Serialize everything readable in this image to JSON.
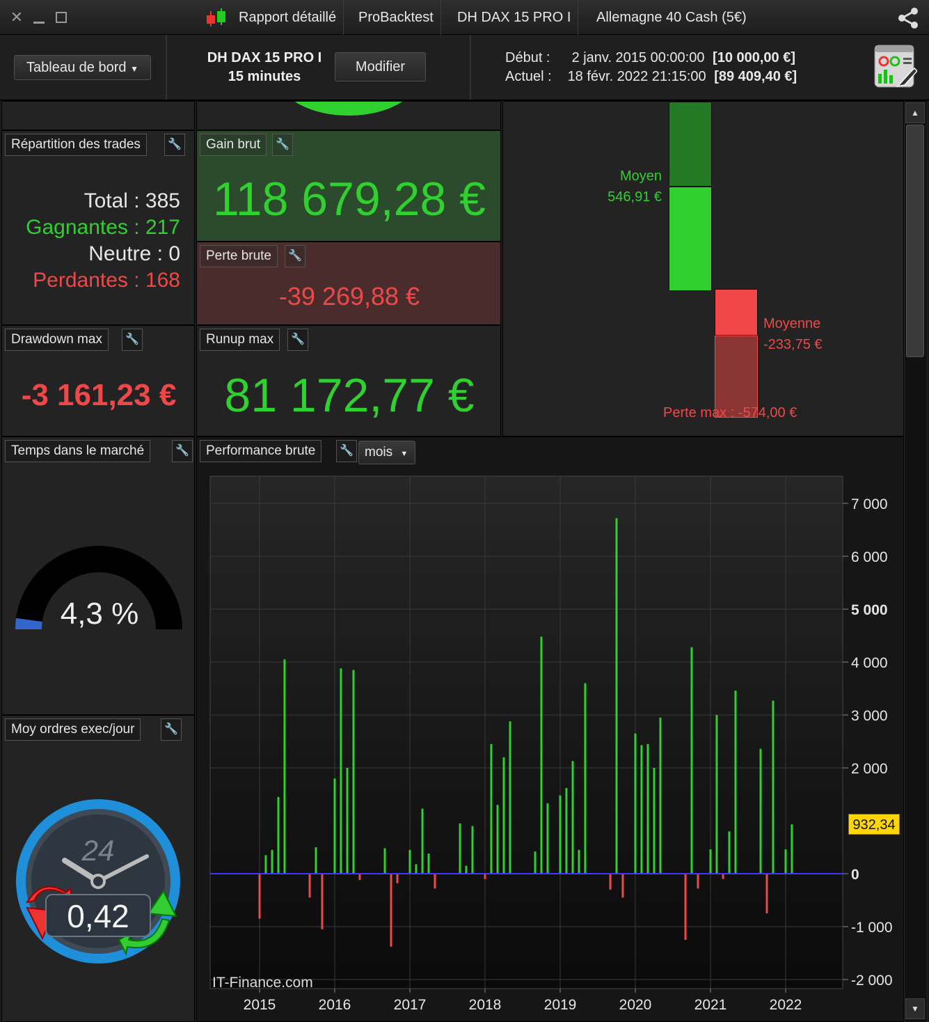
{
  "titlebar": {
    "tabs": [
      "Rapport détaillé",
      "ProBacktest",
      "DH DAX 15 PRO I",
      "Allemagne 40 Cash (5€)"
    ]
  },
  "header": {
    "dropdown_label": "Tableau de bord",
    "strategy_name": "DH DAX 15 PRO I",
    "timeframe": "15 minutes",
    "modify_label": "Modifier",
    "debut_label": "Début :",
    "debut_date": "2 janv. 2015 00:00:00",
    "debut_capital": "[10 000,00 €]",
    "actuel_label": "Actuel :",
    "actuel_date": "18 févr. 2022 21:15:00",
    "actuel_capital": "[89 409,40 €]"
  },
  "trades": {
    "title": "Répartition des trades",
    "total": "Total : 385",
    "gagnantes": "Gagnantes : 217",
    "neutre": "Neutre : 0",
    "perdantes": "Perdantes : 168"
  },
  "gain_brut": {
    "title": "Gain brut",
    "value": "118 679,28 €"
  },
  "perte_brute": {
    "title": "Perte brute",
    "value": "-39 269,88 €"
  },
  "drawdown": {
    "title": "Drawdown max",
    "value": "-3 161,23 €"
  },
  "runup": {
    "title": "Runup max",
    "value": "81 172,77 €"
  },
  "avg_bars": {
    "gain_label": "Moyen",
    "gain_value": "546,91 €",
    "loss_label": "Moyenne",
    "loss_value": "-233,75 €",
    "max_loss": "Perte max : -574,00 €"
  },
  "market_time": {
    "title": "Temps dans le marché",
    "value": "4,3 %",
    "fraction": 0.043
  },
  "orders": {
    "title": "Moy ordres exec/jour",
    "value": "0,42",
    "dial": "24"
  },
  "performance": {
    "title": "Performance brute",
    "period": "mois",
    "watermark": "IT-Finance.com",
    "current_value": "932,34"
  },
  "colors": {
    "positive": "#2fd02f",
    "negative": "#f04848",
    "zero_line": "#3a3aff",
    "highlight": "#ffd700"
  },
  "chart_data": {
    "type": "bar",
    "ylim": [
      -2200,
      7000
    ],
    "yticks": [
      "7 000",
      "6 000",
      "5 000",
      "4 000",
      "3 000",
      "2 000",
      "0",
      "-1 000",
      "-2 000"
    ],
    "ytick_values": [
      7000,
      6000,
      5000,
      4000,
      3000,
      2000,
      0,
      -1000,
      -2000
    ],
    "xticks": [
      "2015",
      "2016",
      "2017",
      "2018",
      "2019",
      "2020",
      "2021",
      "2022"
    ],
    "xtick_values": [
      2015,
      2016,
      2017,
      2018,
      2019,
      2020,
      2021,
      2022
    ],
    "grid": true,
    "x": [
      2015.0,
      2015.083,
      2015.167,
      2015.25,
      2015.333,
      2015.667,
      2015.75,
      2015.833,
      2016.0,
      2016.083,
      2016.167,
      2016.25,
      2016.333,
      2016.667,
      2016.75,
      2016.833,
      2017.0,
      2017.083,
      2017.167,
      2017.25,
      2017.333,
      2017.667,
      2017.75,
      2017.833,
      2018.0,
      2018.083,
      2018.167,
      2018.25,
      2018.333,
      2018.667,
      2018.75,
      2018.833,
      2019.0,
      2019.083,
      2019.167,
      2019.25,
      2019.333,
      2019.667,
      2019.75,
      2019.833,
      2020.0,
      2020.083,
      2020.167,
      2020.25,
      2020.333,
      2020.667,
      2020.75,
      2020.833,
      2021.0,
      2021.083,
      2021.167,
      2021.25,
      2021.333,
      2021.667,
      2021.75,
      2021.833,
      2022.0,
      2022.083
    ],
    "values": [
      -850,
      350,
      450,
      1450,
      4050,
      -450,
      500,
      -1050,
      1800,
      3880,
      2000,
      3850,
      -120,
      480,
      -1380,
      -180,
      450,
      180,
      1230,
      380,
      -280,
      950,
      150,
      900,
      -100,
      2450,
      1300,
      2200,
      2880,
      420,
      4480,
      1330,
      1480,
      1620,
      2130,
      450,
      3600,
      -300,
      6720,
      -450,
      2650,
      2430,
      2450,
      2000,
      2950,
      -1250,
      4280,
      -280,
      460,
      3000,
      -100,
      800,
      3460,
      2360,
      -750,
      3270,
      460,
      932.34
    ]
  }
}
